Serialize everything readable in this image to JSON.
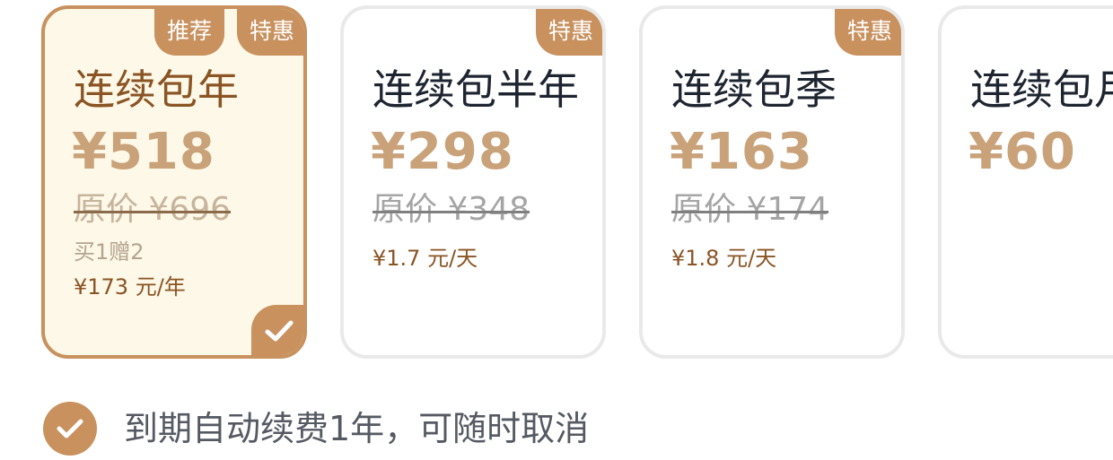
{
  "plans": [
    {
      "name": "连续包年",
      "price": "¥518",
      "original": "原价 ¥696",
      "gift": "买1赠2",
      "per_unit": "¥173 元/年",
      "badges": [
        "推荐",
        "特惠"
      ],
      "selected": true
    },
    {
      "name": "连续包半年",
      "price": "¥298",
      "original": "原价 ¥348",
      "per_unit": "¥1.7 元/天",
      "badges": [
        "特惠"
      ],
      "selected": false
    },
    {
      "name": "连续包季",
      "price": "¥163",
      "original": "原价 ¥174",
      "per_unit": "¥1.8 元/天",
      "badges": [
        "特惠"
      ],
      "selected": false
    },
    {
      "name": "连续包月",
      "price": "¥60",
      "selected": false
    }
  ],
  "agreement": {
    "text": "到期自动续费1年，可随时取消",
    "checked": true
  },
  "colors": {
    "accent": "#c8915e",
    "price": "#c9a279",
    "selected_bg": "#fdf8e7",
    "selected_text": "#8a5424",
    "card_border": "#e9e9e9"
  },
  "icons": {
    "selected_mark": "checkmark-icon",
    "agreement_mark": "checkmark-icon"
  }
}
